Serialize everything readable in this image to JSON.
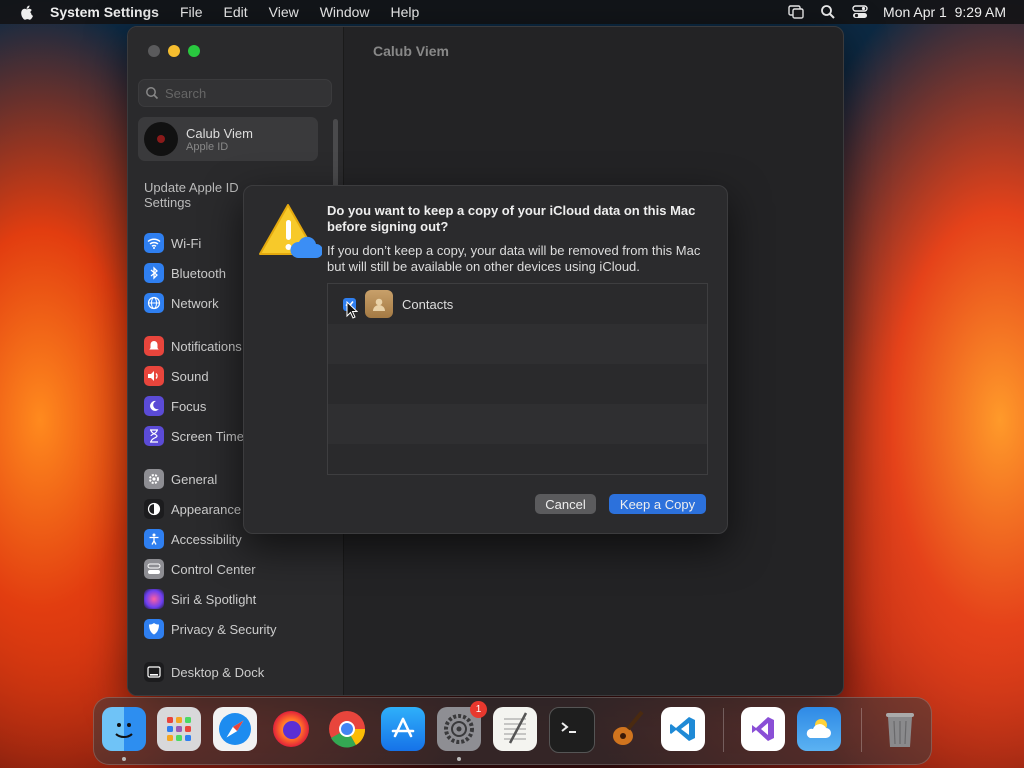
{
  "menubar": {
    "app_name": "System Settings",
    "menus": [
      "File",
      "Edit",
      "View",
      "Window",
      "Help"
    ],
    "datetime": "Mon Apr 1  9:29 AM"
  },
  "window": {
    "content_title": "Calub Viem",
    "search_placeholder": "Search",
    "account": {
      "name": "Calub Viem",
      "subtitle": "Apple ID"
    },
    "update_notice": "Update Apple ID Settings",
    "sidebar_items": [
      {
        "label": "Wi-Fi",
        "icon": "wifi-icon",
        "color": "#2f7ff0"
      },
      {
        "label": "Bluetooth",
        "icon": "bluetooth-icon",
        "color": "#2f7ff0"
      },
      {
        "label": "Network",
        "icon": "network-icon",
        "color": "#2f7ff0"
      },
      {
        "label": "Notifications",
        "icon": "notifications-icon",
        "color": "#e8453c"
      },
      {
        "label": "Sound",
        "icon": "sound-icon",
        "color": "#e8453c"
      },
      {
        "label": "Focus",
        "icon": "focus-icon",
        "color": "#5b4bd6"
      },
      {
        "label": "Screen Time",
        "icon": "screen-time-icon",
        "color": "#5b4bd6"
      },
      {
        "label": "General",
        "icon": "general-icon",
        "color": "#8e8e93"
      },
      {
        "label": "Appearance",
        "icon": "appearance-icon",
        "color": "#1c1c1e"
      },
      {
        "label": "Accessibility",
        "icon": "accessibility-icon",
        "color": "#2f7ff0"
      },
      {
        "label": "Control Center",
        "icon": "control-center-icon",
        "color": "#8e8e93"
      },
      {
        "label": "Siri & Spotlight",
        "icon": "siri-icon",
        "color": "#c03ad8"
      },
      {
        "label": "Privacy & Security",
        "icon": "privacy-icon",
        "color": "#2f7ff0"
      },
      {
        "label": "Desktop & Dock",
        "icon": "desktop-dock-icon",
        "color": "#1c1c1e"
      }
    ]
  },
  "dialog": {
    "title": "Do you want to keep a copy of your iCloud data on this Mac before signing out?",
    "body": "If you don’t keep a copy, your data will be removed from this Mac but will still be available on other devices using iCloud.",
    "items": [
      {
        "label": "Contacts",
        "checked": true
      }
    ],
    "cancel_label": "Cancel",
    "keep_label": "Keep a Copy"
  },
  "dock": {
    "apps": [
      "Finder",
      "Launchpad",
      "Safari",
      "Firefox",
      "Chrome",
      "App Store",
      "System Settings",
      "TextEdit",
      "Terminal",
      "GarageBand",
      "Visual Studio Code",
      "Visual Studio",
      "Weather",
      "Trash"
    ],
    "settings_badge": "1"
  }
}
